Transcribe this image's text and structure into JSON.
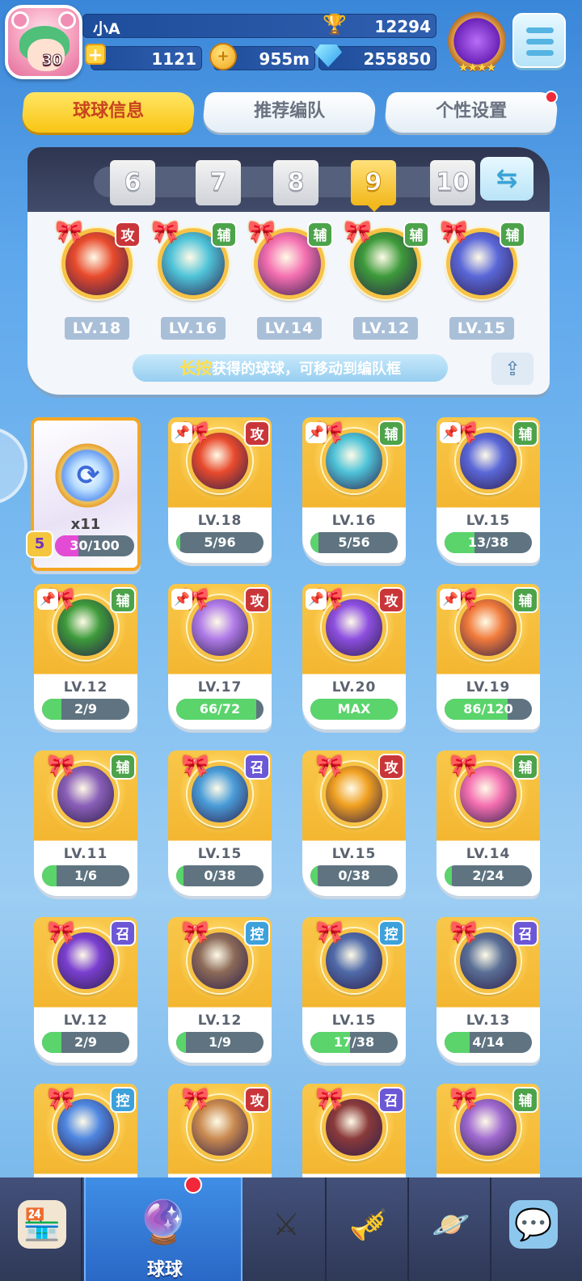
{
  "player": {
    "name": "小A",
    "level": "30",
    "trophies": "12294"
  },
  "resources": {
    "energy": "1121",
    "coin_distance": "955m",
    "diamonds": "255850"
  },
  "tabs": [
    "球球信息",
    "推荐编队",
    "个性设置"
  ],
  "team_slots": [
    "6",
    "7",
    "8",
    "9",
    "10"
  ],
  "active_slot": "9",
  "team_balls": [
    {
      "level": "LV.18",
      "tag": "攻",
      "tag_type": "atk",
      "color": "#e84a2c"
    },
    {
      "level": "LV.16",
      "tag": "辅",
      "tag_type": "sup",
      "color": "#4ec3d8"
    },
    {
      "level": "LV.14",
      "tag": "辅",
      "tag_type": "sup",
      "color": "#f46fb0"
    },
    {
      "level": "LV.12",
      "tag": "辅",
      "tag_type": "sup",
      "color": "#3d9a3a"
    },
    {
      "level": "LV.15",
      "tag": "辅",
      "tag_type": "sup",
      "color": "#5a67d8"
    }
  ],
  "hint": {
    "highlight": "长按",
    "rest": "获得的球球，可移动到编队框"
  },
  "fragment": {
    "count": "x11",
    "progress": "30/100",
    "fraction": 0.3,
    "badge": "5"
  },
  "collection": [
    {
      "level": "LV.18",
      "progress": "5/96",
      "fraction": 0.05,
      "tag": "攻",
      "tag_type": "atk",
      "pinned": true,
      "color": "#e84a2c"
    },
    {
      "level": "LV.16",
      "progress": "5/56",
      "fraction": 0.09,
      "tag": "辅",
      "tag_type": "sup",
      "pinned": true,
      "color": "#4ec3d8"
    },
    {
      "level": "LV.15",
      "progress": "13/38",
      "fraction": 0.34,
      "tag": "辅",
      "tag_type": "sup",
      "pinned": true,
      "color": "#5a67d8"
    },
    {
      "level": "LV.12",
      "progress": "2/9",
      "fraction": 0.22,
      "tag": "辅",
      "tag_type": "sup",
      "pinned": true,
      "color": "#3d9a3a"
    },
    {
      "level": "LV.17",
      "progress": "66/72",
      "fraction": 0.92,
      "tag": "攻",
      "tag_type": "atk",
      "pinned": true,
      "color": "#b07be8"
    },
    {
      "level": "LV.20",
      "progress": "MAX",
      "fraction": 1,
      "tag": "攻",
      "tag_type": "atk",
      "pinned": true,
      "color": "#8d4fe0"
    },
    {
      "level": "LV.19",
      "progress": "86/120",
      "fraction": 0.72,
      "tag": "辅",
      "tag_type": "sup",
      "pinned": true,
      "color": "#f07a3a"
    },
    {
      "level": "LV.11",
      "progress": "1/6",
      "fraction": 0.17,
      "tag": "辅",
      "tag_type": "sup",
      "pinned": false,
      "color": "#8a5fb8"
    },
    {
      "level": "LV.15",
      "progress": "0/38",
      "fraction": 0,
      "tag": "召",
      "tag_type": "sum",
      "pinned": false,
      "color": "#4a9cd8"
    },
    {
      "level": "LV.15",
      "progress": "0/38",
      "fraction": 0,
      "tag": "攻",
      "tag_type": "atk",
      "pinned": false,
      "color": "#f0a020"
    },
    {
      "level": "LV.14",
      "progress": "2/24",
      "fraction": 0.08,
      "tag": "辅",
      "tag_type": "sup",
      "pinned": false,
      "color": "#f46fb0"
    },
    {
      "level": "LV.12",
      "progress": "2/9",
      "fraction": 0.22,
      "tag": "召",
      "tag_type": "sum",
      "pinned": false,
      "color": "#7a3fd0"
    },
    {
      "level": "LV.12",
      "progress": "1/9",
      "fraction": 0.11,
      "tag": "控",
      "tag_type": "ctl",
      "pinned": false,
      "color": "#8c6a58"
    },
    {
      "level": "LV.15",
      "progress": "17/38",
      "fraction": 0.45,
      "tag": "控",
      "tag_type": "ctl",
      "pinned": false,
      "color": "#4f6aa8"
    },
    {
      "level": "LV.13",
      "progress": "4/14",
      "fraction": 0.29,
      "tag": "召",
      "tag_type": "sum",
      "pinned": false,
      "color": "#5a6f96"
    },
    {
      "level": "",
      "progress": "",
      "fraction": 0,
      "tag": "控",
      "tag_type": "ctl",
      "pinned": false,
      "color": "#4e86e0"
    },
    {
      "level": "",
      "progress": "",
      "fraction": 0,
      "tag": "攻",
      "tag_type": "atk",
      "pinned": false,
      "color": "#c98a50"
    },
    {
      "level": "",
      "progress": "",
      "fraction": 0,
      "tag": "召",
      "tag_type": "sum",
      "pinned": false,
      "color": "#8a3a3a"
    },
    {
      "level": "",
      "progress": "",
      "fraction": 0,
      "tag": "辅",
      "tag_type": "sup",
      "pinned": false,
      "color": "#a06ad0"
    }
  ],
  "nav": {
    "active_label": "球球",
    "items": [
      "shop-icon",
      "ball-icon",
      "swords-icon",
      "whistle-icon",
      "planet-icon",
      "chat-icon"
    ]
  }
}
